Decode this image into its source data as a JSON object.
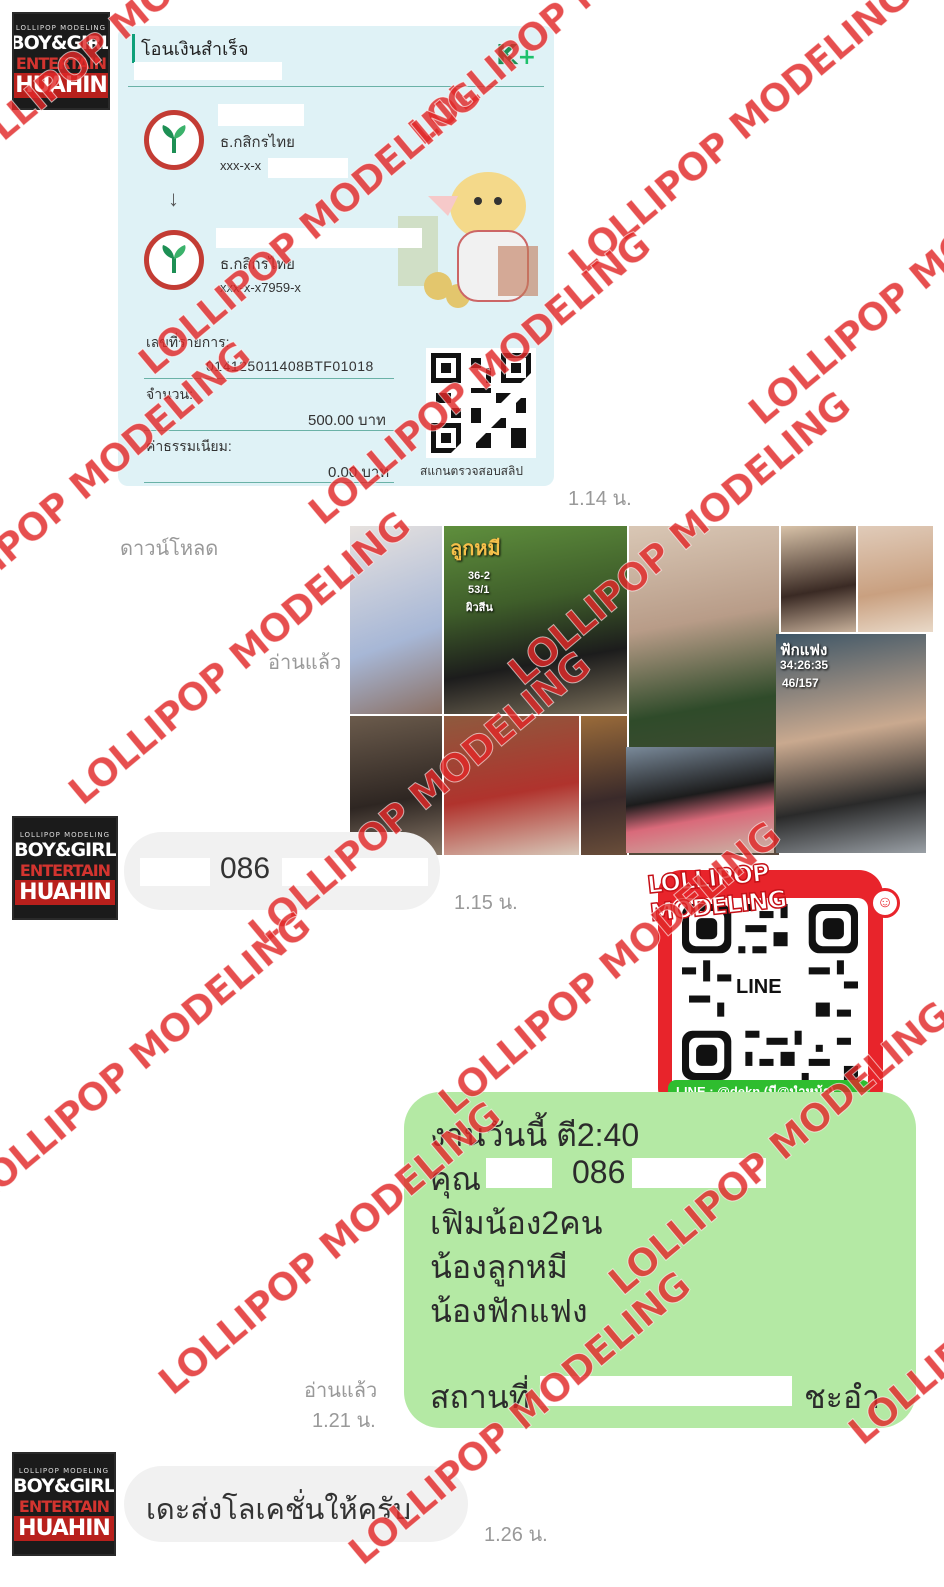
{
  "avatar": {
    "tiny": "LOLLIPOP MODELING",
    "line1": "BOY&GIRL",
    "line2": "ENTERTAIN",
    "line3": "HUAHIN"
  },
  "slip": {
    "header": "โอนเงินสำเร็จ",
    "brand": "K",
    "brand_plus": "+",
    "from_bank": "ธ.กสิกรไทย",
    "from_account": "xxx-x-x",
    "arrow": "↓",
    "to_bank": "ธ.กสิกรไทย",
    "to_account": "xxx-x-x7959-x",
    "ref_label": "เลขที่รายการ:",
    "ref_value": "014125011408BTF01018",
    "amount_label": "จำนวน:",
    "amount_value": "500.00 บาท",
    "fee_label": "ค่าธรรมเนียม:",
    "fee_value": "0.00 บาท",
    "qr_caption": "สแกนตรวจสอบสลิป"
  },
  "messages": {
    "time_1": "1.14 น.",
    "download_label": "ดาวน์โหลด",
    "read_1": "อ่านแล้ว",
    "photo_captions": {
      "a_name": "ลูกหมี",
      "a_stats": "36-2",
      "a_stats2": "53/1",
      "a_skin": "ผิวสีน",
      "b_name": "ฟักแฟง",
      "b_stats": "34:26:35",
      "b_stats2": "46/157"
    },
    "incoming_phone": "086",
    "time_2": "1.15 น.",
    "outgoing_lines": {
      "l1": "งานวันนี้ ตี2:40",
      "l2_prefix": "คุณ",
      "l2_phone": "086",
      "l3": "เฟิมน้อง2คน",
      "l4": "น้องลูกหมี",
      "l5": "น้องฟักแฟง",
      "l6_prefix": "สถานที่",
      "l6_suffix": "ชะอำ"
    },
    "read_2": "อ่านแล้ว",
    "time_3": "1.21 น.",
    "incoming_text": "เดะส่งโลเคชั่นให้ครับ",
    "time_4": "1.26 น."
  },
  "sticker": {
    "title": "LOLLIPOP MODELING",
    "qr_center": "LINE",
    "line_id": "LINE :   @dekn (มี@นำหน้า)",
    "smile": "☺"
  },
  "watermark_text": "LOLLIPOP MODELING",
  "colors": {
    "watermark": "#e12828",
    "outgoing_bubble": "#b4e9a4",
    "incoming_bubble": "#f1f1f1",
    "slip_bg": "#dff2f6",
    "kbank_green": "#1d8f54",
    "sticker_red": "#e8242b",
    "line_green": "#2fbd2f"
  }
}
